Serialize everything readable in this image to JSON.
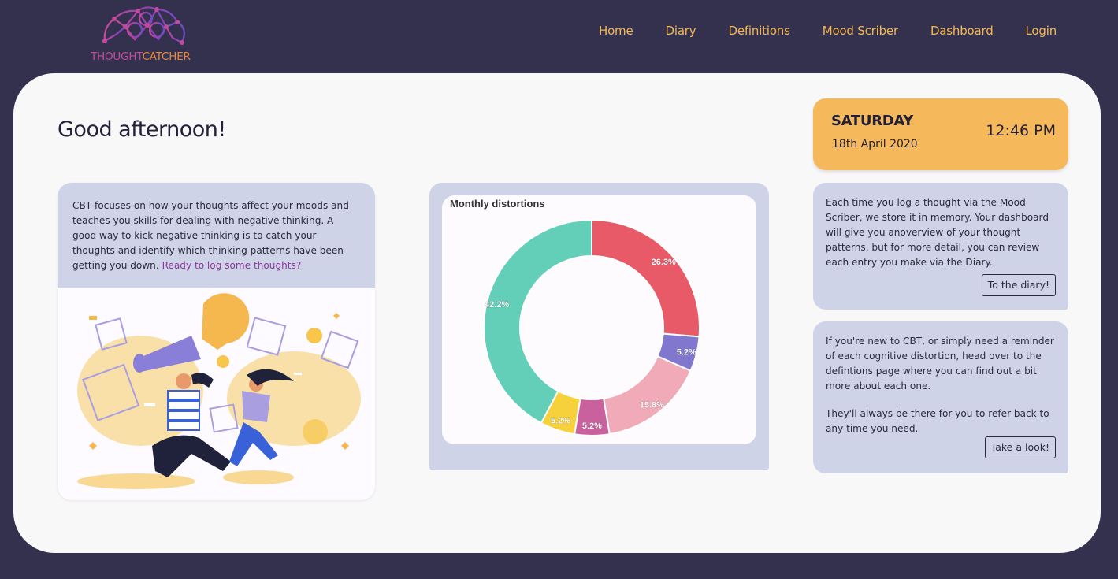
{
  "brand": {
    "name_part1": "THOUGHT",
    "name_part2": "CATCHER",
    "colors": {
      "primary": "#c24c9c",
      "secondary": "#e8883a",
      "accent": "#f5b84e",
      "background": "#34314f"
    }
  },
  "nav": {
    "items": [
      {
        "label": "Home"
      },
      {
        "label": "Diary"
      },
      {
        "label": "Definitions"
      },
      {
        "label": "Mood Scriber"
      },
      {
        "label": "Dashboard"
      },
      {
        "label": "Login"
      }
    ]
  },
  "greeting": "Good afternoon!",
  "intro": {
    "text": "CBT focuses on how your thoughts affect your moods and teaches you skills for dealing with negative thinking. A good way to kick negative thinking is to catch your thoughts and identify which thinking patterns have been getting you down.",
    "link": "Ready to log some thoughts?"
  },
  "date_card": {
    "day": "SATURDAY",
    "date": "18th April 2020",
    "time": "12:46 PM"
  },
  "diary_card": {
    "text": "Each time you log a thought via the Mood Scriber, we store it in memory. Your dashboard will give you anoverview of your thought patterns, but for more detail, you can review each entry you make via the Diary.",
    "button": "To the diary!"
  },
  "definitions_card": {
    "text1": "If you're new to CBT, or simply need a reminder of each cognitive distortion, head over to the defintions page where you can find out a bit more about each one.",
    "text2": "They'll always be there for you to refer back to any time you need.",
    "button": "Take a look!"
  },
  "chart_data": {
    "type": "pie",
    "title": "Monthly distortions",
    "donut": true,
    "slices": [
      {
        "value": 26.3,
        "label": "26.3%",
        "color": "#e95a68"
      },
      {
        "value": 5.2,
        "label": "5.2%",
        "color": "#8277cf"
      },
      {
        "value": 15.8,
        "label": "15.8%",
        "color": "#f0aab8"
      },
      {
        "value": 5.2,
        "label": "5.2%",
        "color": "#c9619e"
      },
      {
        "value": 5.2,
        "label": "5.2%",
        "color": "#f6d13c"
      },
      {
        "value": 42.2,
        "label": "42.2%",
        "color": "#64cfb8"
      }
    ]
  }
}
